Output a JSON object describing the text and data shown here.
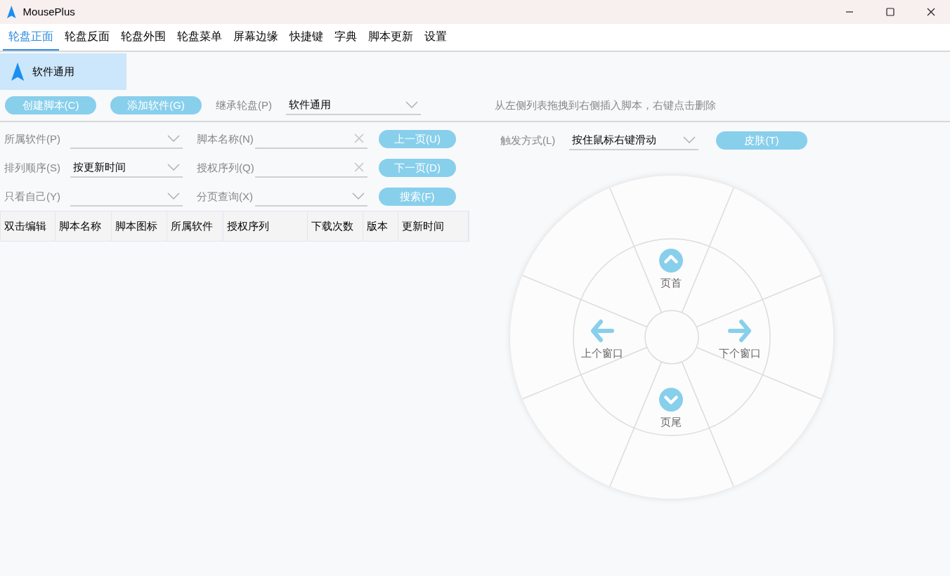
{
  "window": {
    "title": "MousePlus"
  },
  "tabs": [
    {
      "label": "轮盘正面",
      "selected": true
    },
    {
      "label": "轮盘反面",
      "selected": false
    },
    {
      "label": "轮盘外围",
      "selected": false
    },
    {
      "label": "轮盘菜单",
      "selected": false
    },
    {
      "label": "屏幕边缘",
      "selected": false
    },
    {
      "label": "快捷键",
      "selected": false
    },
    {
      "label": "字典",
      "selected": false
    },
    {
      "label": "脚本更新",
      "selected": false
    },
    {
      "label": "设置",
      "selected": false
    }
  ],
  "software_list": [
    {
      "label": "软件通用",
      "selected": true
    }
  ],
  "toolbar": {
    "buttons": [
      "创建脚本(C)",
      "添加软件(G)"
    ],
    "inherit_label": "继承轮盘(P)",
    "inherit_value": "软件通用",
    "hint": "从左侧列表拖拽到右侧插入脚本，右键点击删除"
  },
  "filters": [
    {
      "label": "所属软件(P)",
      "kind": "select",
      "field": {
        "label": "脚本名称(N)",
        "kind": "text"
      },
      "button": "上一页(U)"
    },
    {
      "label": "排列顺序(S)",
      "kind": "select",
      "value": "按更新时间",
      "field": {
        "label": "授权序列(Q)",
        "kind": "text"
      },
      "button": "下一页(D)"
    },
    {
      "label": "只看自己(Y)",
      "kind": "select",
      "field": {
        "label": "分页查询(X)",
        "kind": "select"
      },
      "button": "搜索(F)"
    }
  ],
  "table": {
    "columns": [
      "双击编辑",
      "脚本名称",
      "脚本图标",
      "所属软件",
      "授权序列",
      "下载次数",
      "版本",
      "更新时间"
    ]
  },
  "trigger": {
    "label": "触发方式(L)",
    "value": "按住鼠标右键滑动",
    "button": "皮肤(T)"
  },
  "wheel": {
    "slots": [
      {
        "kind": "up",
        "label": "页首"
      },
      {
        "kind": "left",
        "label": "上个窗口"
      },
      {
        "kind": "right",
        "label": "下个窗口"
      },
      {
        "kind": "down",
        "label": "页尾"
      }
    ]
  }
}
